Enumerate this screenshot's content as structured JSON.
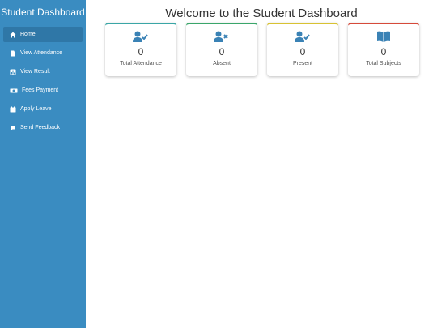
{
  "sidebar": {
    "title": "Student Dashboard",
    "items": [
      {
        "label": "Home",
        "icon": "home-icon",
        "active": true
      },
      {
        "label": "View Attendance",
        "icon": "document-icon"
      },
      {
        "label": "View Result",
        "icon": "chart-icon"
      },
      {
        "label": "Fees Payment",
        "icon": "money-icon"
      },
      {
        "label": "Apply Leave",
        "icon": "calendar-icon"
      },
      {
        "label": "Send Feedback",
        "icon": "comment-icon"
      }
    ]
  },
  "main": {
    "title": "Welcome to the Student Dashboard",
    "cards": [
      {
        "label": "Total Attendance",
        "value": "0",
        "icon": "user-check-icon",
        "accent": "#3aa6a6"
      },
      {
        "label": "Absent",
        "value": "0",
        "icon": "user-times-icon",
        "accent": "#3aa66a"
      },
      {
        "label": "Present",
        "value": "0",
        "icon": "user-check-icon",
        "accent": "#d8c232"
      },
      {
        "label": "Total Subjects",
        "value": "0",
        "icon": "book-icon",
        "accent": "#d64a3a"
      }
    ]
  },
  "colors": {
    "sidebar_bg": "#3a8cc1",
    "sidebar_active": "#2f77a7",
    "icon_blue": "#3a82b5"
  }
}
